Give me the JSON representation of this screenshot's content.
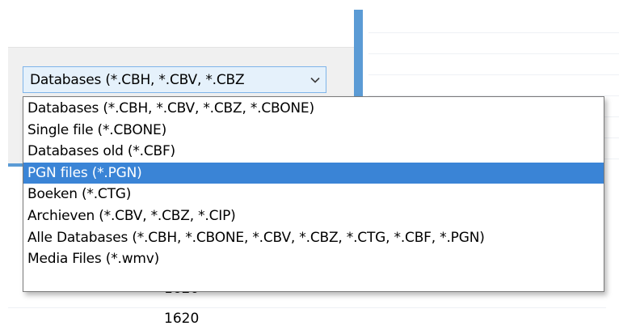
{
  "combo": {
    "selected_label": "Databases (*.CBH, *.CBV, *.CBZ",
    "chevron_icon": "chevron-down-icon"
  },
  "dropdown": {
    "options": [
      {
        "label": "Databases (*.CBH, *.CBV, *.CBZ, *.CBONE)"
      },
      {
        "label": "Single file (*.CBONE)"
      },
      {
        "label": "Databases old (*.CBF)"
      },
      {
        "label": "PGN files (*.PGN)",
        "selected": true
      },
      {
        "label": "Boeken (*.CTG)"
      },
      {
        "label": "Archieven (*.CBV, *.CBZ, *.CIP)"
      },
      {
        "label": "Alle Databases (*.CBH, *.CBONE, *.CBV, *.CBZ, *.CTG, *.CBF, *.PGN)"
      },
      {
        "label": "Media Files (*.wmv)"
      }
    ]
  },
  "background": {
    "numbers": [
      "1620",
      "1620"
    ]
  },
  "colors": {
    "accent_blue": "#5b9bd5",
    "selection": "#3a84d6",
    "combo_bg": "#e5f1fb",
    "combo_border": "#7eb4ea",
    "panel_bg": "#f0f0f0"
  }
}
